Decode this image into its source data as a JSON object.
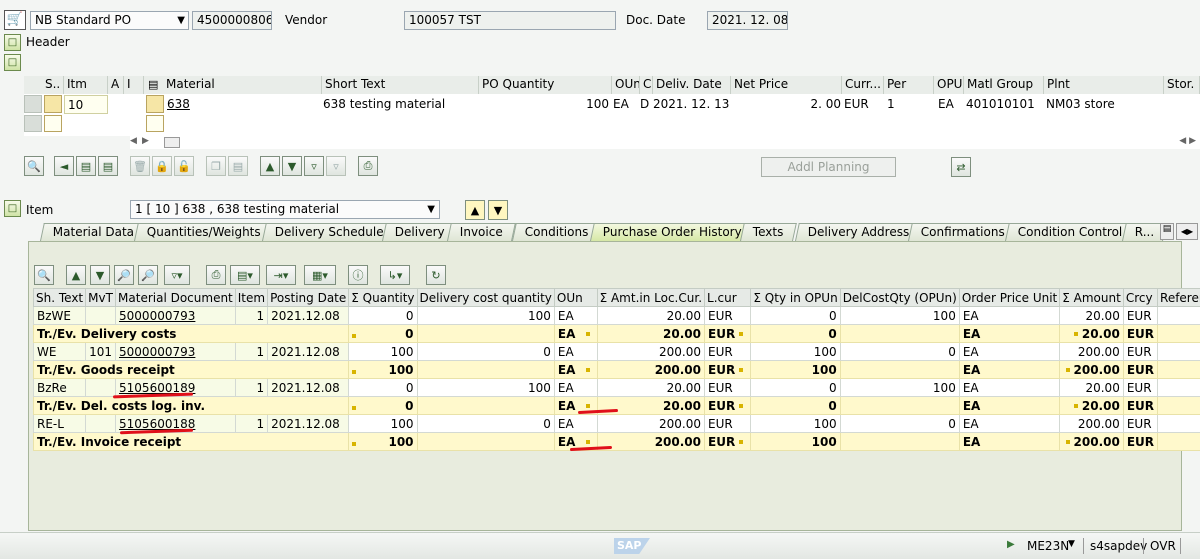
{
  "header_bar": {
    "po_type": "NB Standard PO",
    "po_number": "4500000806",
    "vendor_label": "Vendor",
    "vendor_value": "100057 TST",
    "doc_date_label": "Doc. Date",
    "doc_date_value": "2021. 12. 08",
    "header_label": "Header"
  },
  "item_grid": {
    "columns": [
      "S..",
      "Itm",
      "A",
      "I",
      "Material",
      "Short Text",
      "PO Quantity",
      "OUn",
      "C",
      "Deliv. Date",
      "Net Price",
      "Curr...",
      "Per",
      "OPU",
      "Matl Group",
      "Plnt",
      "Stor. L"
    ],
    "row": {
      "itm": "10",
      "material": "638",
      "short_text": "638 testing material",
      "po_quantity": "100",
      "oun": "EA",
      "c": "D",
      "deliv_date": "2021. 12. 13",
      "net_price": "2. 00",
      "curr": "EUR",
      "per": "1",
      "opu": "EA",
      "matl_group": "401010101",
      "plnt": "NM03 store"
    }
  },
  "toolbar": {
    "addl_planning": "Addl Planning"
  },
  "item_section": {
    "label": "Item",
    "selected_item": "1 [ 10 ] 638 , 638 testing material"
  },
  "tabs": [
    "Material Data",
    "Quantities/Weights",
    "Delivery Schedule",
    "Delivery",
    "Invoice",
    "Conditions",
    "Purchase Order History",
    "Texts",
    "Delivery Address",
    "Confirmations",
    "Condition Control",
    "R..."
  ],
  "history": {
    "columns": [
      "Sh. Text",
      "MvT",
      "Material Document",
      "Item",
      "Posting Date",
      "Σ Quantity",
      "Delivery cost quantity",
      "OUn",
      "Σ Amt.in Loc.Cur.",
      "L.cur",
      "Σ Qty in OPUn",
      "DelCostQty (OPUn)",
      "Order Price Unit",
      "Σ  Amount",
      "Crcy",
      "Reference"
    ],
    "rows": [
      {
        "type": "row",
        "sh": "BzWE",
        "mvt": "",
        "doc": "5000000793",
        "item": "1",
        "date": "2021.12.08",
        "qty": "0",
        "dcq": "100",
        "oun": "EA",
        "amt": "20.00",
        "lcur": "EUR",
        "qopun": "0",
        "dcqo": "100",
        "opu": "EA",
        "amount": "20.00",
        "crcy": "EUR",
        "ref": ""
      },
      {
        "type": "tot",
        "sh": "Tr./Ev. Delivery costs",
        "qty": "0",
        "oun": "EA",
        "amt": "20.00",
        "lcur": "EUR",
        "qopun": "0",
        "opu": "EA",
        "amount": "20.00",
        "crcy": "EUR"
      },
      {
        "type": "row",
        "sh": "WE",
        "mvt": "101",
        "doc": "5000000793",
        "item": "1",
        "date": "2021.12.08",
        "qty": "100",
        "dcq": "0",
        "oun": "EA",
        "amt": "200.00",
        "lcur": "EUR",
        "qopun": "100",
        "dcqo": "0",
        "opu": "EA",
        "amount": "200.00",
        "crcy": "EUR",
        "ref": ""
      },
      {
        "type": "tot",
        "sh": "Tr./Ev. Goods receipt",
        "qty": "100",
        "oun": "EA",
        "amt": "200.00",
        "lcur": "EUR",
        "qopun": "100",
        "opu": "EA",
        "amount": "200.00",
        "crcy": "EUR"
      },
      {
        "type": "row",
        "sh": "BzRe",
        "mvt": "",
        "doc": "5105600189",
        "item": "1",
        "date": "2021.12.08",
        "qty": "0",
        "dcq": "100",
        "oun": "EA",
        "amt": "20.00",
        "lcur": "EUR",
        "qopun": "0",
        "dcqo": "100",
        "opu": "EA",
        "amount": "20.00",
        "crcy": "EUR",
        "ref": ""
      },
      {
        "type": "tot",
        "sh": "Tr./Ev. Del. costs log. inv.",
        "qty": "0",
        "oun": "EA",
        "amt": "20.00",
        "lcur": "EUR",
        "qopun": "0",
        "opu": "EA",
        "amount": "20.00",
        "crcy": "EUR"
      },
      {
        "type": "row",
        "sh": "RE-L",
        "mvt": "",
        "doc": "5105600188",
        "item": "1",
        "date": "2021.12.08",
        "qty": "100",
        "dcq": "0",
        "oun": "EA",
        "amt": "200.00",
        "lcur": "EUR",
        "qopun": "100",
        "dcqo": "0",
        "opu": "EA",
        "amount": "200.00",
        "crcy": "EUR",
        "ref": ""
      },
      {
        "type": "tot",
        "sh": "Tr./Ev. Invoice receipt",
        "qty": "100",
        "oun": "EA",
        "amt": "200.00",
        "lcur": "EUR",
        "qopun": "100",
        "opu": "EA",
        "amount": "200.00",
        "crcy": "EUR"
      }
    ]
  },
  "status_bar": {
    "logo": "SAP",
    "transaction": "ME23N",
    "system": "s4sapdev",
    "mode": "OVR"
  },
  "colors": {
    "total_row": "#fff9cc",
    "active_tab": "#d6e8a6",
    "annotation": "#e0101a"
  }
}
